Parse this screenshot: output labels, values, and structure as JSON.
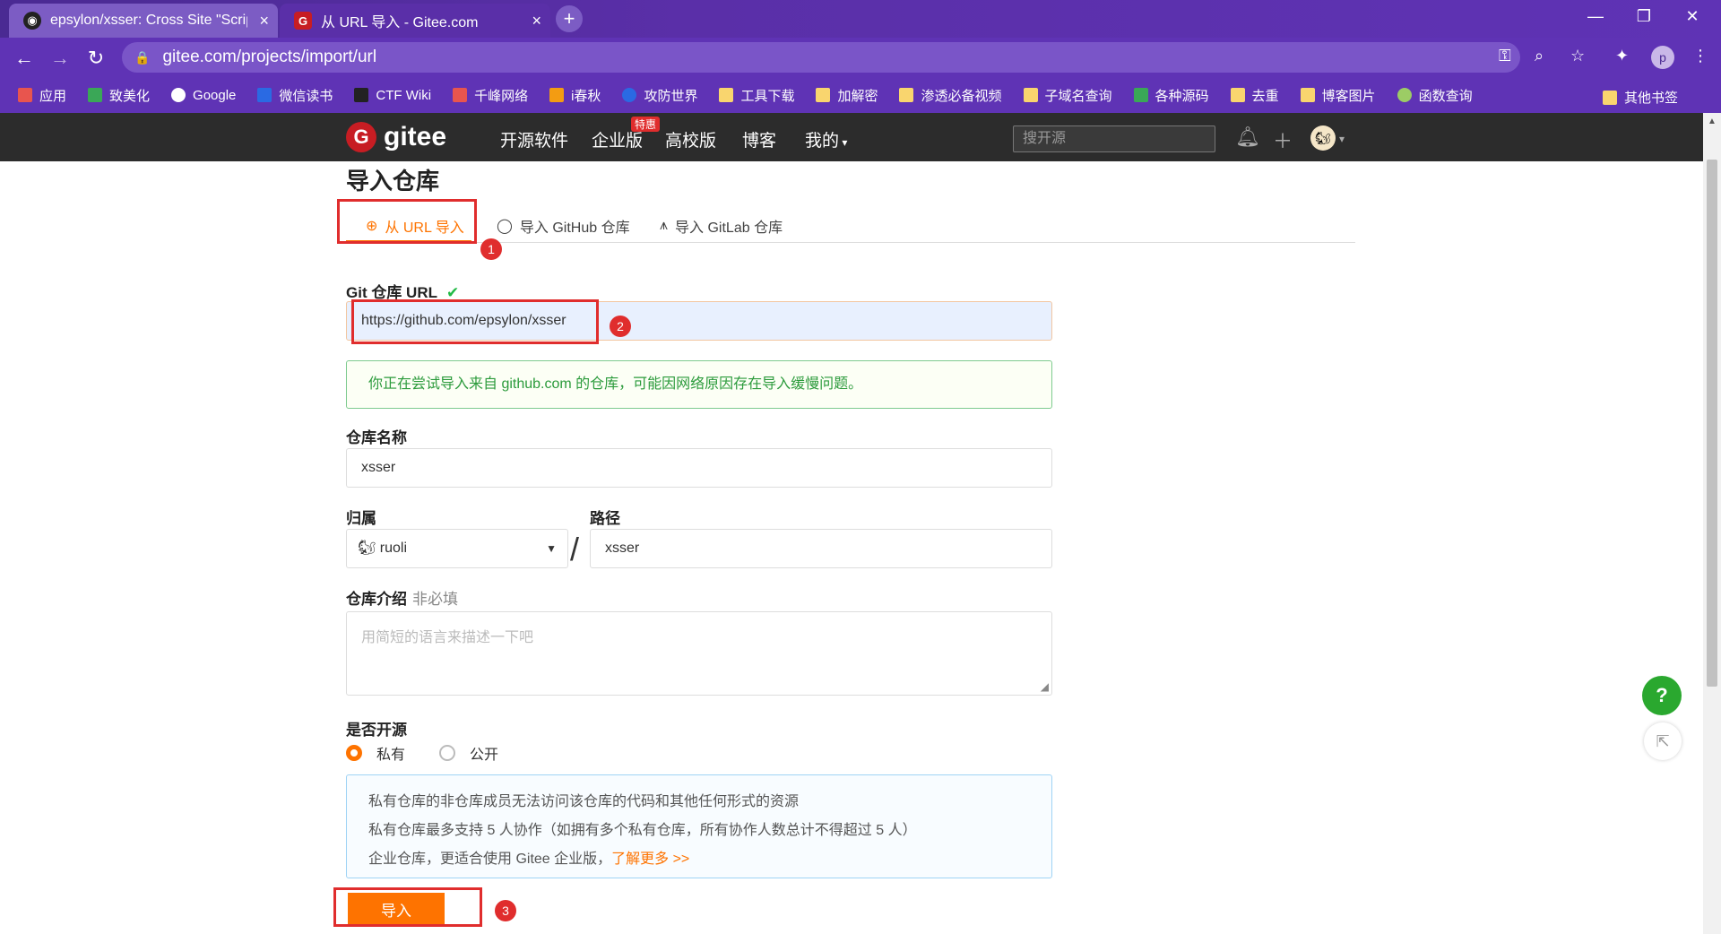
{
  "browser": {
    "tabs": [
      {
        "title": "epsylon/xsser: Cross Site \"Scrip",
        "close": "×"
      },
      {
        "title": "从 URL 导入 - Gitee.com",
        "close": "×"
      }
    ],
    "new_tab": "+",
    "url": "gitee.com/projects/import/url",
    "profile_initial": "p",
    "bookmarks": [
      "应用",
      "致美化",
      "Google",
      "微信读书",
      "CTF Wiki",
      "千峰网络",
      "i春秋",
      "攻防世界",
      "工具下载",
      "加解密",
      "渗透必备视频",
      "子域名查询",
      "各种源码",
      "去重",
      "博客图片",
      "函数查询"
    ],
    "other_bookmarks": "其他书签"
  },
  "gitee": {
    "logo": "gitee",
    "nav": {
      "open_source": "开源软件",
      "enterprise": "企业版",
      "badge": "特惠",
      "edu": "高校版",
      "blog": "博客",
      "mine": "我的"
    },
    "search_placeholder": "搜开源"
  },
  "page": {
    "title": "导入仓库",
    "tabs": [
      "从 URL 导入",
      "导入 GitHub 仓库",
      "导入 GitLab 仓库"
    ],
    "git_url_label": "Git 仓库 URL",
    "git_url_value": "https://github.com/epsylon/xsser",
    "notice": "你正在尝试导入来自 github.com 的仓库，可能因网络原因存在导入缓慢问题。",
    "repo_name_label": "仓库名称",
    "repo_name_value": "xsser",
    "owner_label": "归属",
    "owner_value": "ruoli",
    "path_label": "路径",
    "path_value": "xsser",
    "intro_label": "仓库介绍",
    "intro_optional": "非必填",
    "intro_placeholder": "用简短的语言来描述一下吧",
    "open_label": "是否开源",
    "radio_private": "私有",
    "radio_public": "公开",
    "info_lines": [
      "私有仓库的非仓库成员无法访问该仓库的代码和其他任何形式的资源",
      "私有仓库最多支持 5 人协作（如拥有多个私有仓库，所有协作人数总计不得超过 5 人）",
      "企业仓库，更适合使用 Gitee 企业版，"
    ],
    "info_link": "了解更多 >>",
    "submit": "导入"
  },
  "annotations": [
    "1",
    "2",
    "3"
  ],
  "help": "?",
  "colors": {
    "accent": "#fe7300",
    "brand": "#c71d23",
    "chrome": "#5f33b5",
    "success": "#21ba45",
    "annotation": "#e02d2d"
  }
}
